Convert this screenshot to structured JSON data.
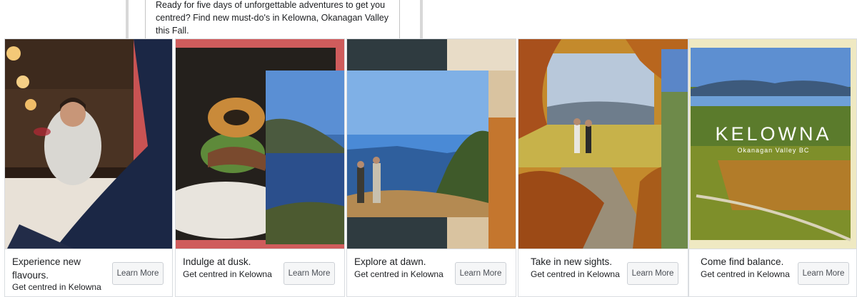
{
  "post": {
    "text": "Ready for five days of unforgettable adventures to get you centred? Find new must-do's in Kelowna, Okanagan Valley this Fall."
  },
  "carousel": {
    "cards": [
      {
        "headline": "Experience new flavours.",
        "subline": "Get centred in Kelowna",
        "cta": "Learn More"
      },
      {
        "headline": "Indulge at dusk.",
        "subline": "Get centred in Kelowna",
        "cta": "Learn More"
      },
      {
        "headline": "Explore at dawn.",
        "subline": "Get centred in Kelowna",
        "cta": "Learn More"
      },
      {
        "headline": "Take in new sights.",
        "subline": "Get centred in Kelowna",
        "cta": "Learn More"
      },
      {
        "headline": "Come find balance.",
        "subline": "Get centred in Kelowna",
        "cta": "Learn More"
      }
    ],
    "logo": {
      "name": "KELOWNA",
      "tagline": "Okanagan Valley BC"
    }
  },
  "colors": {
    "red_frame": "#cf5c5c",
    "slate_panel": "#2f3b40",
    "cream_frame": "#efe9c2",
    "button_bg": "#f5f6f7"
  }
}
